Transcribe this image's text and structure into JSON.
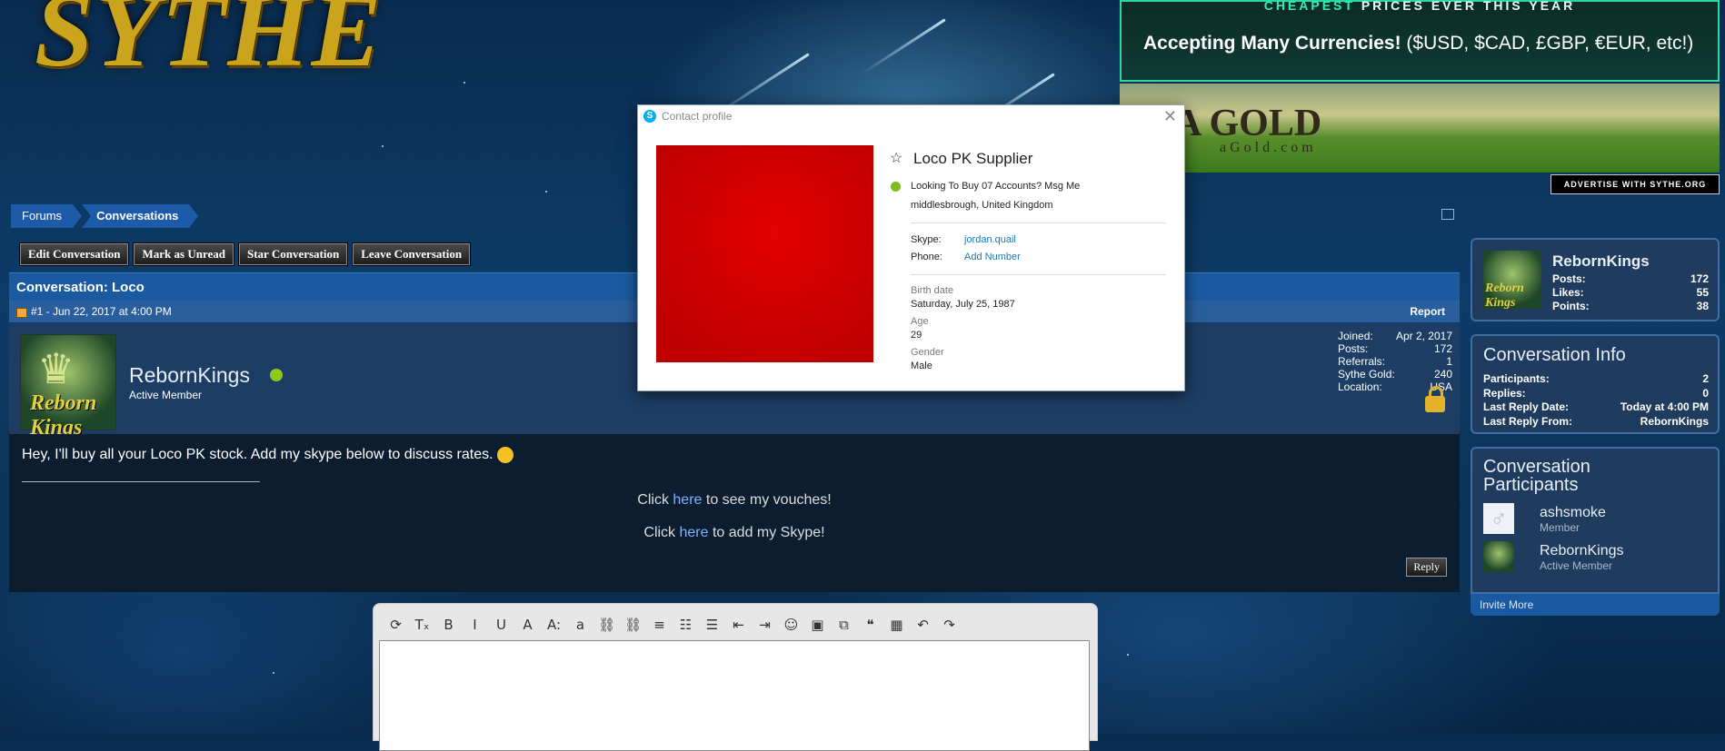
{
  "logo": {
    "text": "SYTHE"
  },
  "ads": {
    "top_tagline_accent": "CHEAPEST",
    "top_tagline_rest": " PRICES EVER THIS YEAR",
    "top_currencies_bold": "Accepting Many Currencies!",
    "top_currencies_rest": " ($USD, $CAD, £GBP, €EUR, etc!)",
    "bottom_brand": "A GOLD",
    "bottom_brand_sub": "aGold.com",
    "advertise": "ADVERTISE WITH SYTHE.ORG"
  },
  "breadcrumb": {
    "forums": "Forums",
    "conversations": "Conversations"
  },
  "actions": {
    "edit": "Edit Conversation",
    "mark_unread": "Mark as Unread",
    "star": "Star Conversation",
    "leave": "Leave Conversation"
  },
  "conversation": {
    "title": "Conversation: Loco",
    "post_id": "#1 - Jun 22, 2017 at 4:00 PM",
    "report": "Report",
    "user": {
      "name": "RebornKings",
      "title": "Active Member",
      "avatar_text": "Reborn Kings"
    },
    "stats": [
      {
        "label": "Joined:",
        "value": "Apr 2, 2017"
      },
      {
        "label": "Posts:",
        "value": "172"
      },
      {
        "label": "Referrals:",
        "value": "1"
      },
      {
        "label": "Sythe Gold:",
        "value": "240"
      },
      {
        "label": "Location:",
        "value": "USA"
      }
    ],
    "body": "Hey, I'll buy all your Loco PK stock. Add my skype below to discuss rates.",
    "line1_pre": "Click ",
    "line1_link": "here",
    "line1_post": " to see my vouches!",
    "line2_pre": "Click ",
    "line2_link": "here",
    "line2_post": " to add my Skype!",
    "reply": "Reply"
  },
  "editor": {
    "tools": [
      "remove-format-icon",
      "clear-format-icon",
      "bold-icon",
      "italic-icon",
      "underline-icon",
      "text-color-icon",
      "font-size-icon",
      "font-family-icon",
      "link-icon",
      "unlink-icon",
      "align-icon",
      "bullet-list-icon",
      "number-list-icon",
      "outdent-icon",
      "indent-icon",
      "smiley-icon",
      "image-icon",
      "media-icon",
      "quote-icon",
      "save-icon",
      "undo-icon",
      "redo-icon"
    ],
    "tool_glyphs": [
      "⟳",
      "Tₓ",
      "B",
      "I",
      "U",
      "A",
      "A:",
      "a",
      "⛓",
      "⛓",
      "≡",
      "☷",
      "☰",
      "⇤",
      "⇥",
      "☺",
      "▣",
      "⧉",
      "❝",
      "▦",
      "↶",
      "↷"
    ]
  },
  "sidebar": {
    "user": {
      "name": "RebornKings",
      "stats": [
        {
          "label": "Posts:",
          "value": "172"
        },
        {
          "label": "Likes:",
          "value": "55"
        },
        {
          "label": "Points:",
          "value": "38"
        }
      ]
    },
    "info": {
      "title": "Conversation Info",
      "rows": [
        {
          "label": "Participants:",
          "value": "2"
        },
        {
          "label": "Replies:",
          "value": "0"
        },
        {
          "label": "Last Reply Date:",
          "value": "Today at 4:00 PM"
        },
        {
          "label": "Last Reply From:",
          "value": "RebornKings"
        }
      ]
    },
    "participants": {
      "title": "Conversation Participants",
      "list": [
        {
          "name": "ashsmoke",
          "role": "Member"
        },
        {
          "name": "RebornKings",
          "role": "Active Member"
        }
      ],
      "invite": "Invite More"
    }
  },
  "skype_dialog": {
    "title": "Contact profile",
    "name": "Loco PK Supplier",
    "mood": "Looking To Buy 07 Accounts? Msg Me",
    "location": "middlesbrough, United Kingdom",
    "skype_label": "Skype:",
    "skype_value": "jordan.quail",
    "phone_label": "Phone:",
    "phone_value": "Add Number",
    "birth_label": "Birth date",
    "birth_value": "Saturday, July 25, 1987",
    "age_label": "Age",
    "age_value": "29",
    "gender_label": "Gender",
    "gender_value": "Male"
  },
  "colors": {
    "accent": "#1b5aa1",
    "online": "#8cc91b",
    "skype": "#00aff0"
  }
}
